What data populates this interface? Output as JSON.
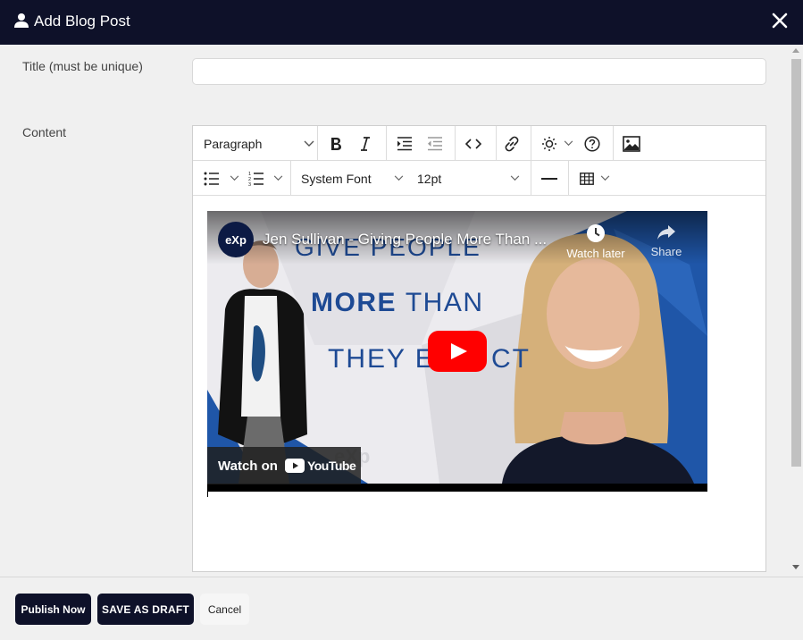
{
  "header": {
    "title": "Add Blog Post",
    "icon": "user-icon",
    "close_icon": "close-icon",
    "bg_color": "#0e1129"
  },
  "form": {
    "title_label": "Title (must be unique)",
    "title_value": "",
    "title_placeholder": "",
    "content_label": "Content"
  },
  "toolbar": {
    "block_format": "Paragraph",
    "font_family": "System Font",
    "font_size": "12pt",
    "row1_icons": [
      "bold-icon",
      "italic-icon",
      "indent-icon",
      "outdent-icon",
      "code-icon",
      "link-icon",
      "brightness-icon",
      "help-icon",
      "image-icon"
    ],
    "row2_icons": [
      "bullet-list-icon",
      "numbered-list-icon",
      "horizontal-rule-icon",
      "table-icon"
    ]
  },
  "video": {
    "title": "Jen Sullivan - Giving People More Than ...",
    "channel_logo": "eXp",
    "watch_later": "Watch later",
    "share": "Share",
    "watch_on": "Watch on",
    "brand": "YouTube",
    "thumbnail_text": {
      "line1": "GIVE PEOPLE",
      "line2_bold": "MORE",
      "line2_rest": " THAN",
      "line3": "THEY E",
      "line3_end": "CT"
    },
    "watermark": "eXp"
  },
  "footer": {
    "publish_label": "Publish Now",
    "draft_label": "SAVE AS DRAFT",
    "cancel_label": "Cancel",
    "primary_color": "#0e1129"
  }
}
